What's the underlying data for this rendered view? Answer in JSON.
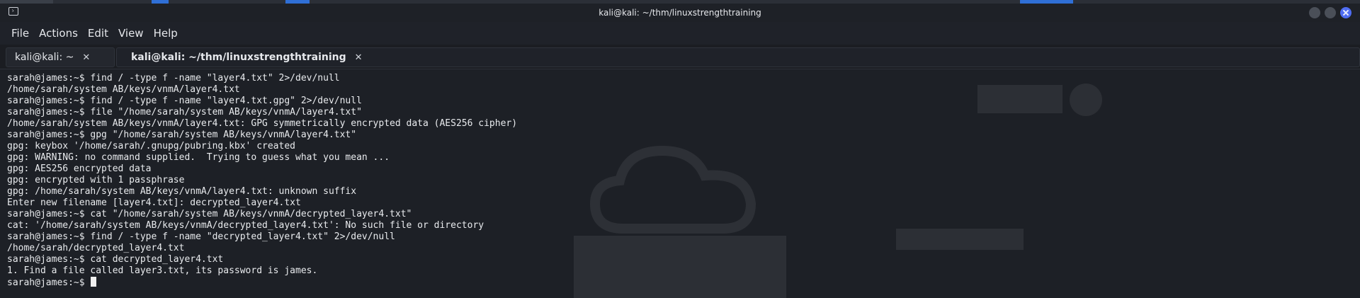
{
  "window": {
    "title": "kali@kali: ~/thm/linuxstrengthtraining"
  },
  "menu": [
    "File",
    "Actions",
    "Edit",
    "View",
    "Help"
  ],
  "tabs": [
    {
      "label": "kali@kali: ~",
      "close": "✕"
    },
    {
      "label": "kali@kali: ~/thm/linuxstrengthtraining",
      "close": "✕"
    }
  ],
  "terminal": {
    "lines": [
      "sarah@james:~$ find / -type f -name \"layer4.txt\" 2>/dev/null",
      "/home/sarah/system AB/keys/vnmA/layer4.txt",
      "sarah@james:~$ find / -type f -name \"layer4.txt.gpg\" 2>/dev/null",
      "sarah@james:~$ file \"/home/sarah/system AB/keys/vnmA/layer4.txt\"",
      "/home/sarah/system AB/keys/vnmA/layer4.txt: GPG symmetrically encrypted data (AES256 cipher)",
      "sarah@james:~$ gpg \"/home/sarah/system AB/keys/vnmA/layer4.txt\"",
      "gpg: keybox '/home/sarah/.gnupg/pubring.kbx' created",
      "gpg: WARNING: no command supplied.  Trying to guess what you mean ...",
      "gpg: AES256 encrypted data",
      "gpg: encrypted with 1 passphrase",
      "gpg: /home/sarah/system AB/keys/vnmA/layer4.txt: unknown suffix",
      "Enter new filename [layer4.txt]: decrypted_layer4.txt",
      "sarah@james:~$ cat \"/home/sarah/system AB/keys/vnmA/decrypted_layer4.txt\"",
      "cat: '/home/sarah/system AB/keys/vnmA/decrypted_layer4.txt': No such file or directory",
      "sarah@james:~$ find / -type f -name \"decrypted_layer4.txt\" 2>/dev/null",
      "/home/sarah/decrypted_layer4.txt",
      "sarah@james:~$ cat decrypted_layer4.txt",
      "1. Find a file called layer3.txt, its password is james."
    ],
    "prompt": "sarah@james:~$ "
  },
  "colors": {
    "terminal_bg": "#1d2026",
    "text": "#e9ebee",
    "close_button": "#4f6df3"
  }
}
